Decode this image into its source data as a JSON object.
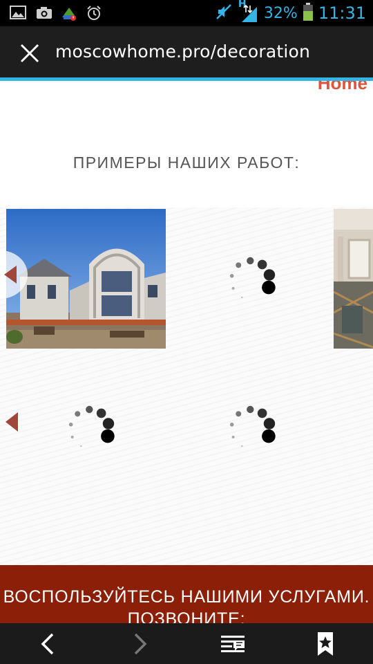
{
  "status_bar": {
    "icons": [
      "image-icon",
      "camera-icon",
      "storage-warning-icon",
      "alarm-icon",
      "mute-icon",
      "signal-icon",
      "battery-icon"
    ],
    "network": "H",
    "battery_percent": "32%",
    "time": "11:31"
  },
  "url_bar": {
    "url": "moscowhome.pro/decoration",
    "close_icon": "close-icon"
  },
  "page": {
    "logo_fragment": "Home",
    "section_title": "ПРИМЕРЫ НАШИХ РАБОТ:",
    "gallery": {
      "items": [
        {
          "kind": "photo",
          "subject": "house-exterior"
        },
        {
          "kind": "loading"
        },
        {
          "kind": "photo",
          "subject": "house-scaffolding"
        },
        {
          "kind": "loading"
        },
        {
          "kind": "loading"
        }
      ]
    }
  },
  "banner": {
    "line1": "ВОСПОЛЬЗУЙТЕСЬ НАШИМИ УСЛУГАМИ.",
    "line2": "ПОЗВОНИТЕ:"
  },
  "bottom_nav": {
    "icons": [
      "back-icon",
      "forward-icon",
      "reading-mode-icon",
      "bookmark-icon"
    ]
  },
  "colors": {
    "accent": "#33b5e5",
    "banner": "#8c1f07",
    "logo": "#e0533b",
    "arrow": "#a0463a"
  }
}
